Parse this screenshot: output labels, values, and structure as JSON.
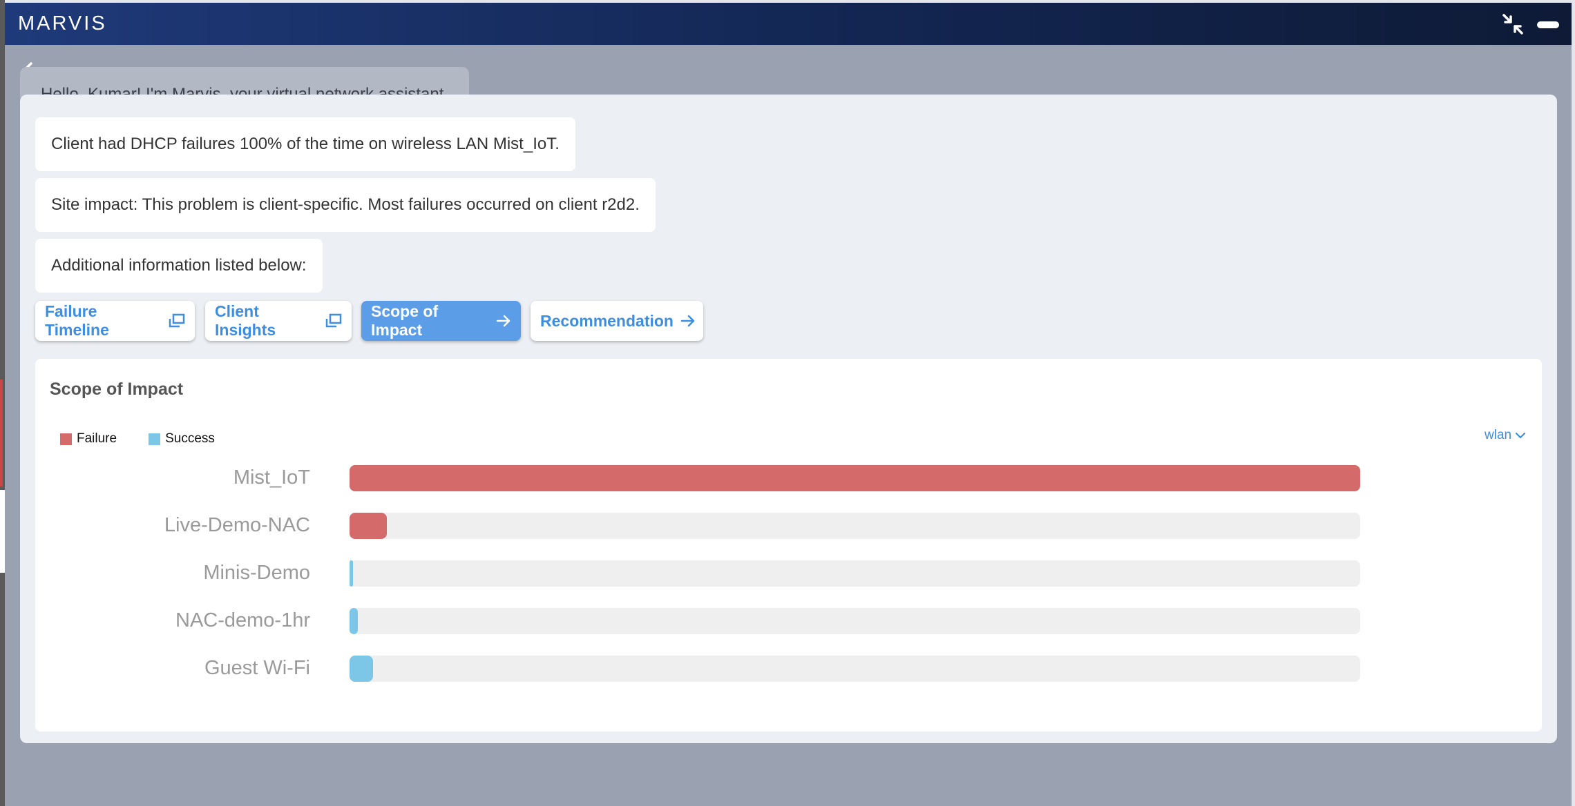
{
  "window": {
    "title": "MARVIS"
  },
  "greeting": {
    "text": "Hello, Kumar! I'm Marvis, your virtual network assistant."
  },
  "messages": [
    "Client had DHCP failures 100% of the time on wireless LAN Mist_IoT.",
    "Site impact: This problem is client-specific. Most failures occurred on client r2d2.",
    "Additional information listed below:"
  ],
  "actions": [
    {
      "label": "Failure Timeline",
      "icon": "popout-icon",
      "active": false
    },
    {
      "label": "Client Insights",
      "icon": "popout-icon",
      "active": false
    },
    {
      "label": "Scope of Impact",
      "icon": "arrow-right-icon",
      "active": true
    },
    {
      "label": "Recommendation",
      "icon": "arrow-right-icon",
      "active": false
    }
  ],
  "scope": {
    "title": "Scope of Impact",
    "legend": {
      "failure": "Failure",
      "success": "Success"
    },
    "dropdown": "wlan",
    "colors": {
      "failure": "#d46a6a",
      "success": "#7cc6e8",
      "track": "#efefef",
      "accent": "#3d8ee0"
    }
  },
  "chart_data": {
    "type": "bar",
    "orientation": "horizontal",
    "categories": [
      "Mist_IoT",
      "Live-Demo-NAC",
      "Minis-Demo",
      "NAC-demo-1hr",
      "Guest Wi-Fi"
    ],
    "series": [
      {
        "name": "Failure",
        "values": [
          100,
          3.7,
          0,
          0,
          0
        ]
      },
      {
        "name": "Success",
        "values": [
          0,
          0,
          0.3,
          0.8,
          2.3
        ]
      }
    ],
    "xlim": [
      0,
      100
    ],
    "legend_position": "top-left"
  }
}
